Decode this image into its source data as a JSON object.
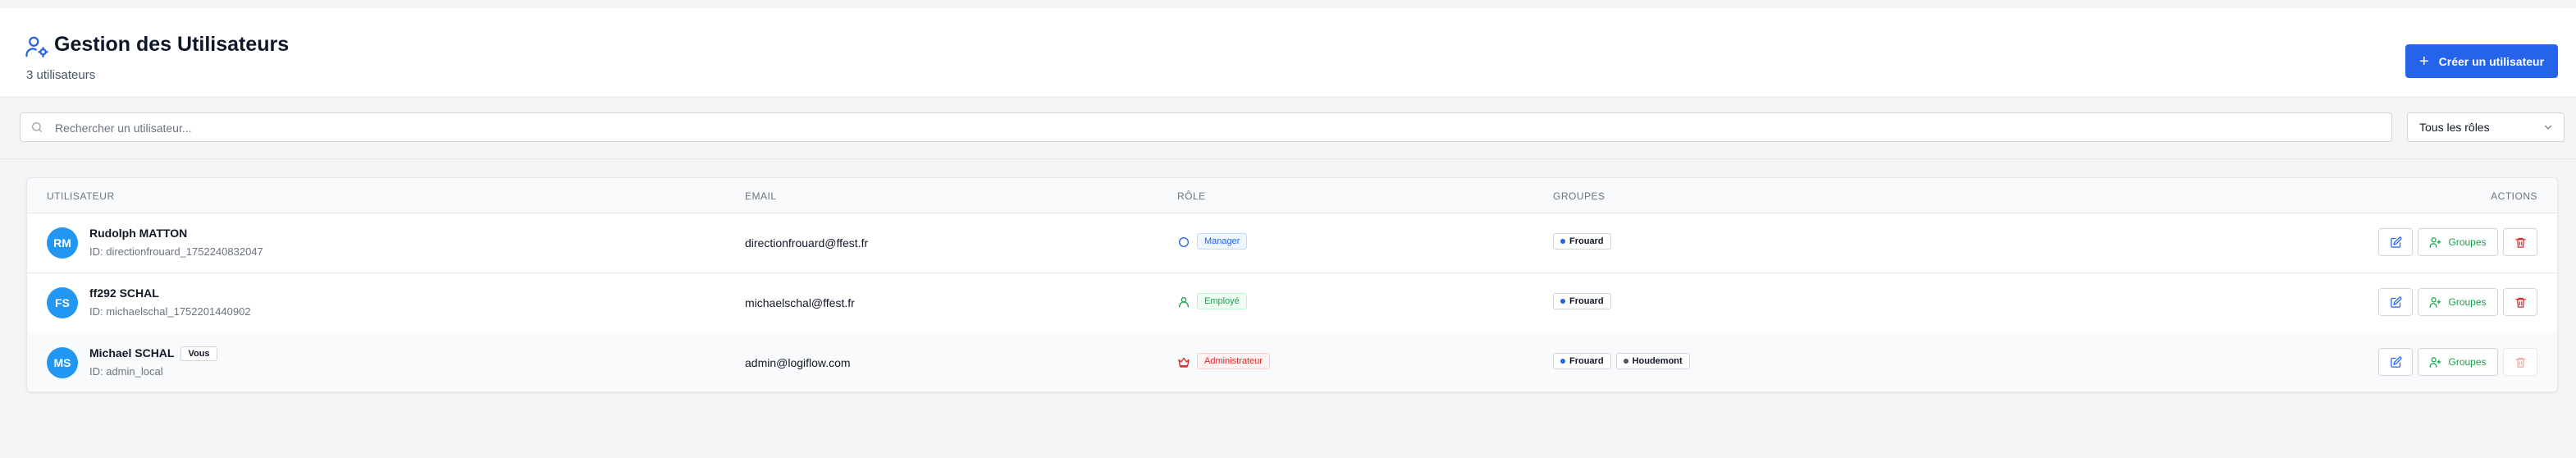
{
  "header": {
    "title": "Gestion des Utilisateurs",
    "subtitle": "3 utilisateurs",
    "create_button": "Créer un utilisateur",
    "accent": "#2563eb"
  },
  "filters": {
    "search_placeholder": "Rechercher un utilisateur...",
    "search_value": "",
    "role_filter": "Tous les rôles"
  },
  "table": {
    "headers": {
      "user": "UTILISATEUR",
      "email": "EMAIL",
      "role": "RÔLE",
      "groups": "GROUPES",
      "actions": "ACTIONS"
    },
    "groups_button": "Groupes",
    "rows": [
      {
        "initials": "RM",
        "name": "Rudolph MATTON",
        "id_line": "ID: directionfrouard_1752240832047",
        "you_badge": "",
        "email": "directionfrouard@ffest.fr",
        "role": "Manager",
        "role_icon": "circle-icon",
        "role_color": "#2563eb",
        "role_bg": "#eff6ff",
        "role_border": "#bfdbfe",
        "groups": [
          {
            "name": "Frouard",
            "color": "#2563eb"
          }
        ],
        "delete_disabled": false
      },
      {
        "initials": "FS",
        "name": "ff292 SCHAL",
        "id_line": "ID: michaelschal_1752201440902",
        "you_badge": "",
        "email": "michaelschal@ffest.fr",
        "role": "Employé",
        "role_icon": "user-icon",
        "role_color": "#16a34a",
        "role_bg": "#f0fdf4",
        "role_border": "#bbf7d0",
        "groups": [
          {
            "name": "Frouard",
            "color": "#2563eb"
          }
        ],
        "delete_disabled": false
      },
      {
        "initials": "MS",
        "name": "Michael SCHAL",
        "id_line": "ID: admin_local",
        "you_badge": "Vous",
        "email": "admin@logiflow.com",
        "role": "Administrateur",
        "role_icon": "crown-icon",
        "role_color": "#dc2626",
        "role_bg": "#fef2f2",
        "role_border": "#fecaca",
        "groups": [
          {
            "name": "Frouard",
            "color": "#2563eb"
          },
          {
            "name": "Houdemont",
            "color": "#4b5563"
          }
        ],
        "delete_disabled": true
      }
    ]
  }
}
